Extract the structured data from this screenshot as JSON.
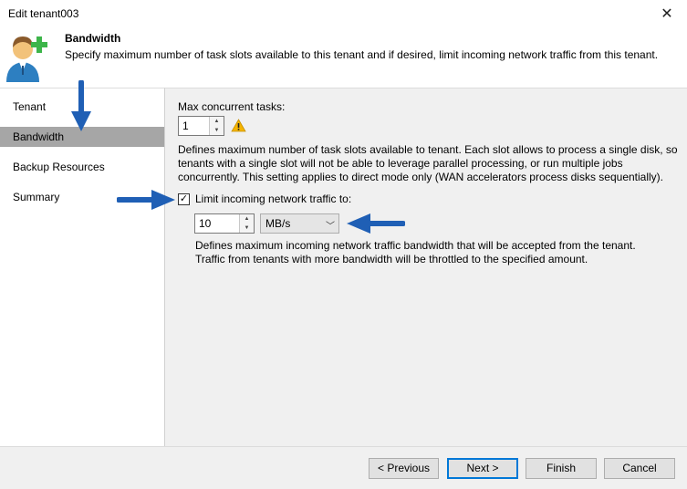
{
  "window": {
    "title": "Edit tenant003",
    "close_glyph": "✕"
  },
  "header": {
    "title": "Bandwidth",
    "description": "Specify maximum number of task slots available to this tenant and if desired, limit incoming network traffic from this tenant.",
    "icon": "tenant-add-icon"
  },
  "sidebar": {
    "items": [
      {
        "label": "Tenant",
        "selected": false
      },
      {
        "label": "Bandwidth",
        "selected": true
      },
      {
        "label": "Backup Resources",
        "selected": false
      },
      {
        "label": "Summary",
        "selected": false
      }
    ]
  },
  "main": {
    "max_tasks_label": "Max concurrent tasks:",
    "max_tasks_value": "1",
    "max_tasks_desc": [
      "Defines maximum number of task slots available to tenant. Each slot allows to process a single disk, so",
      "tenants with a single slot will not be able to leverage parallel processing, or run multiple jobs",
      "concurrently. This setting applies to direct mode only (WAN accelerators process disks sequentially)."
    ],
    "limit_label": "Limit incoming network traffic to:",
    "limit_checked": true,
    "limit_value": "10",
    "unit_selected": "MB/s",
    "limit_desc": [
      "Defines maximum incoming network traffic bandwidth that will be accepted from the tenant.",
      "Traffic from tenants with more bandwidth will be throttled to the specified amount."
    ]
  },
  "footer": {
    "previous_label": "< Previous",
    "next_label": "Next >",
    "finish_label": "Finish",
    "cancel_label": "Cancel"
  },
  "colors": {
    "accent": "#0078d7",
    "arrow": "#1f5fb5",
    "warning": "#f5b400",
    "selected": "#a6a6a6"
  }
}
